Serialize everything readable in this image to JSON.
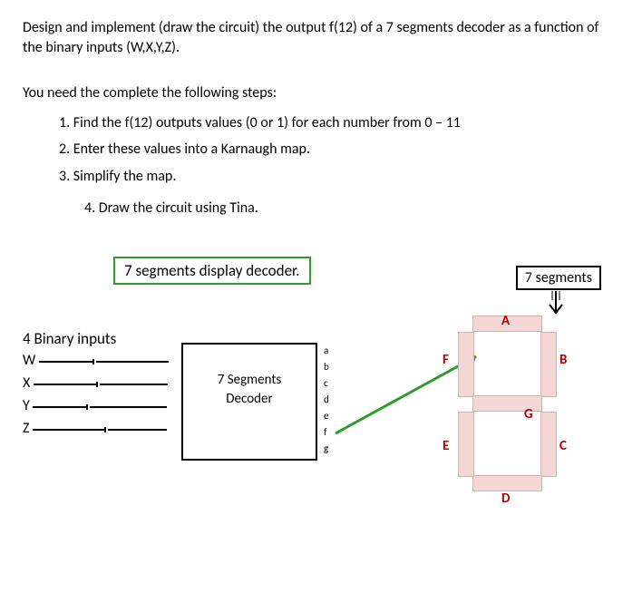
{
  "prompt": "Design and implement (draw the circuit) the output f(12) of a 7 segments decoder as a function of  the binary inputs (W,X,Y,Z).",
  "steps_intro": "You need the complete the following steps:",
  "steps": {
    "s1": "1. Find the f(12) outputs values (0 or 1) for each number from 0 – 11",
    "s2": "2. Enter these values into a Karnaugh map.",
    "s3": "3.  Simplify the map.",
    "s4": "4. Draw the circuit using Tina."
  },
  "diagram": {
    "decoder_title": "7 segments display decoder.",
    "inputs_header": "4 Binary inputs",
    "inputs": {
      "w": "W",
      "x": "X",
      "y": "Y",
      "z": "Z"
    },
    "decoder_label_1": "7 Segments",
    "decoder_label_2": "Decoder",
    "outputs": {
      "a": "a",
      "b": "b",
      "c": "c",
      "d": "d",
      "e": "e",
      "f": "f",
      "g": "g"
    },
    "display_label": "7 segments",
    "segments": {
      "a": "A",
      "b": "B",
      "c": "C",
      "d": "D",
      "e": "E",
      "f": "F",
      "g": "G"
    }
  }
}
